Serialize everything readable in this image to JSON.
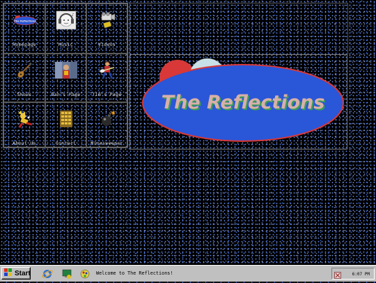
{
  "nav": {
    "items": [
      {
        "label": "Homepage",
        "icon": "reflections-logo-icon"
      },
      {
        "label": "Music",
        "icon": "headphones-face-icon"
      },
      {
        "label": "Videos",
        "icon": "video-camera-icon"
      },
      {
        "label": "Shows",
        "icon": "guitar-icon"
      },
      {
        "label": "Dan's Page",
        "icon": "dan-photo-icon"
      },
      {
        "label": "Tim's Page",
        "icon": "tim-guitarist-icon"
      },
      {
        "label": "About Us",
        "icon": "running-figure-icon"
      },
      {
        "label": "Contact",
        "icon": "phone-keypad-icon"
      },
      {
        "label": "Minesweeper",
        "icon": "bomb-icon"
      }
    ],
    "logo_mini_text": "The Reflections"
  },
  "banner": {
    "title": "The Reflections",
    "colors": {
      "ellipse": "#2a56d8",
      "border": "#d83838",
      "text": "#d8b0a8",
      "shadow": "#3a9a5a"
    }
  },
  "taskbar": {
    "start_label": "Start",
    "status": "Welcome to The Reflections!",
    "clock": "6:07 PM",
    "quick_icons": [
      "internet-explorer-icon",
      "desktop-icon",
      "channels-icon"
    ]
  }
}
